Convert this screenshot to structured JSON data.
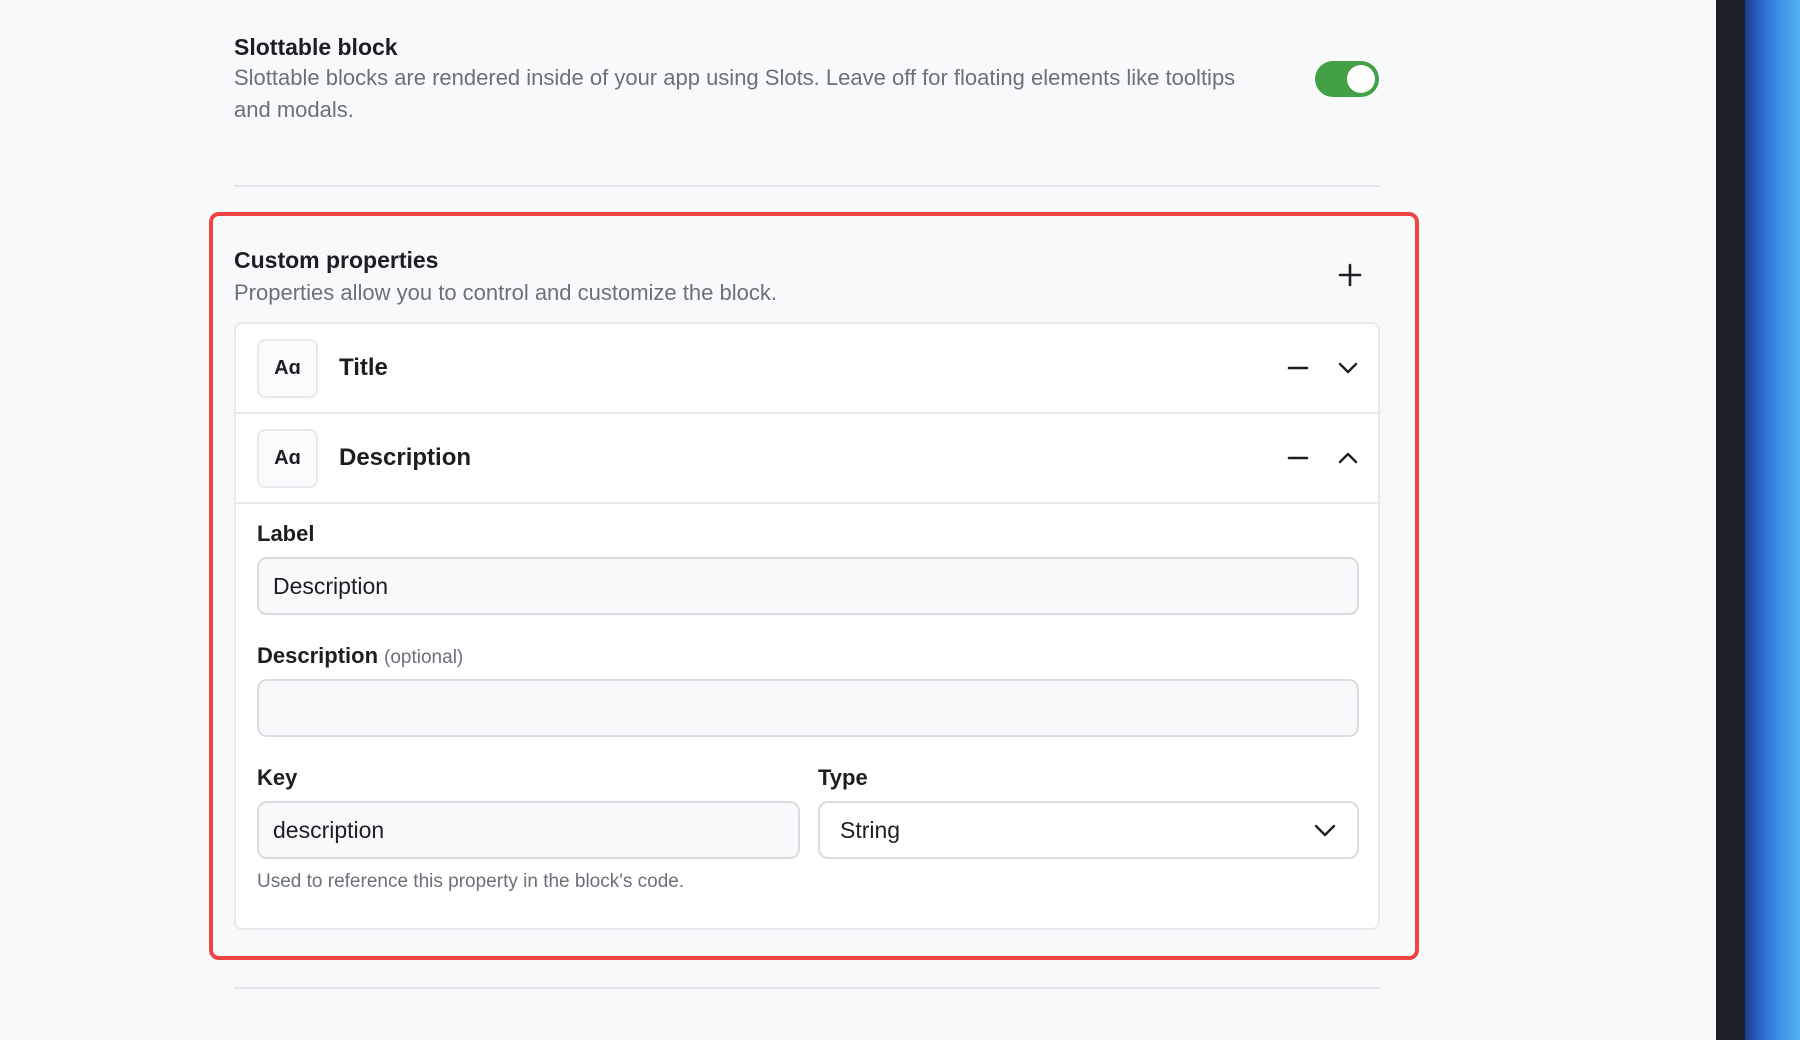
{
  "slottable": {
    "title": "Slottable block",
    "description": "Slottable blocks are rendered inside of your app using Slots. Leave off for floating elements like tooltips and modals.",
    "enabled": true
  },
  "custom_properties": {
    "title": "Custom properties",
    "description": "Properties allow you to control and customize the block.",
    "icon_add": "plus-icon",
    "items": [
      {
        "icon_text": "Aɑ",
        "name": "Title",
        "expanded": false
      },
      {
        "icon_text": "Aɑ",
        "name": "Description",
        "expanded": true
      }
    ],
    "form": {
      "label_label": "Label",
      "label_value": "Description",
      "description_label": "Description",
      "description_optional": "(optional)",
      "description_value": "",
      "key_label": "Key",
      "key_value": "description",
      "type_label": "Type",
      "type_value": "String",
      "key_helper": "Used to reference this property in the block's code."
    }
  },
  "colors": {
    "toggle_on": "#43a047",
    "highlight": "#ef4444",
    "muted_text": "#6b7079"
  }
}
